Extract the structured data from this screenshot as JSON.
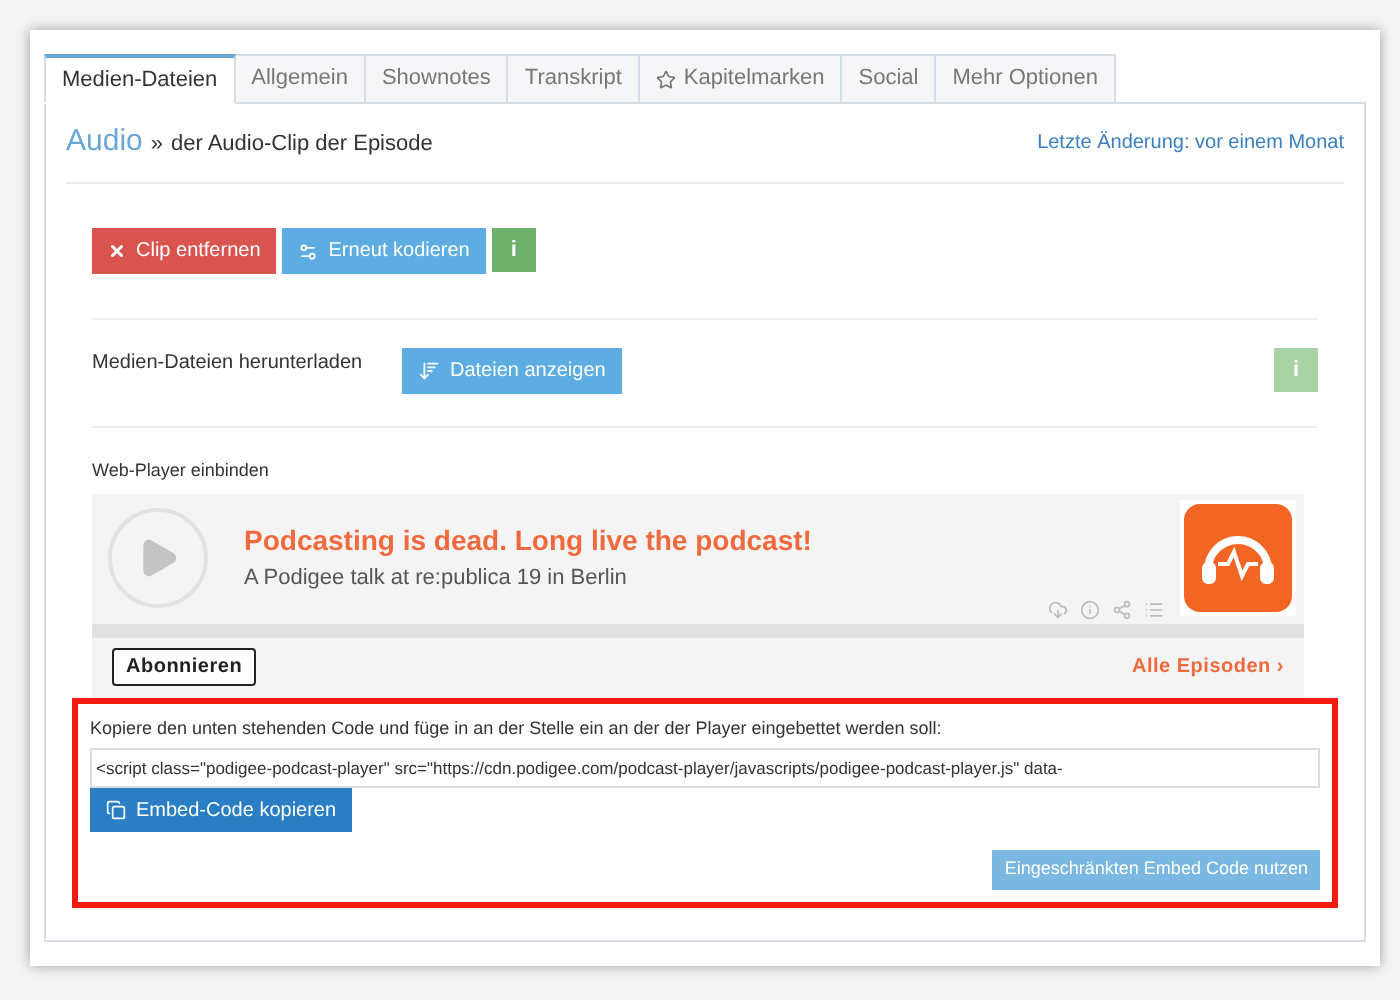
{
  "tabs": [
    {
      "label": "Medien-Dateien",
      "selected": true,
      "kind": "plain"
    },
    {
      "label": "Allgemein",
      "selected": false,
      "kind": "plain"
    },
    {
      "label": "Shownotes",
      "selected": false,
      "kind": "plain"
    },
    {
      "label": "Transkript",
      "selected": false,
      "kind": "plain"
    },
    {
      "label": "Kapitelmarken",
      "selected": false,
      "kind": "starred"
    },
    {
      "label": "Social",
      "selected": false,
      "kind": "plain"
    },
    {
      "label": "Mehr Optionen",
      "selected": false,
      "kind": "plain"
    }
  ],
  "breadcrumb": {
    "link": "Audio",
    "separator": "»",
    "title": "der Audio-Clip der Episode"
  },
  "last_change": "Letzte Änderung: vor einem Monat",
  "actions": [
    {
      "label": "Clip entfernen",
      "kind": "danger"
    },
    {
      "label": "Erneut kodieren",
      "kind": "primary"
    },
    {
      "label": "i",
      "kind": "info",
      "disabled": false
    }
  ],
  "download": {
    "label": "Medien-Dateien herunterladen",
    "button": "Dateien anzeigen",
    "info": {
      "label": "i",
      "disabled": true
    }
  },
  "web_player": {
    "label": "Web-Player einbinden",
    "title": "Podcasting is dead. Long live the podcast!",
    "subtitle": "A Podigee talk at re:publica 19 in Berlin",
    "subscribe": "Abonnieren",
    "all_episodes": "Alle Episoden ›"
  },
  "embed": {
    "instruction": "Kopiere den unten stehenden Code und füge in an der Stelle ein an der der Player eingebettet werden soll:",
    "code": "<script class=\"podigee-podcast-player\" src=\"https://cdn.podigee.com/podcast-player/javascripts/podigee-podcast-player.js\" data-",
    "copy_button": "Embed-Code kopieren",
    "restricted_button": "Eingeschränkten Embed Code nutzen"
  }
}
